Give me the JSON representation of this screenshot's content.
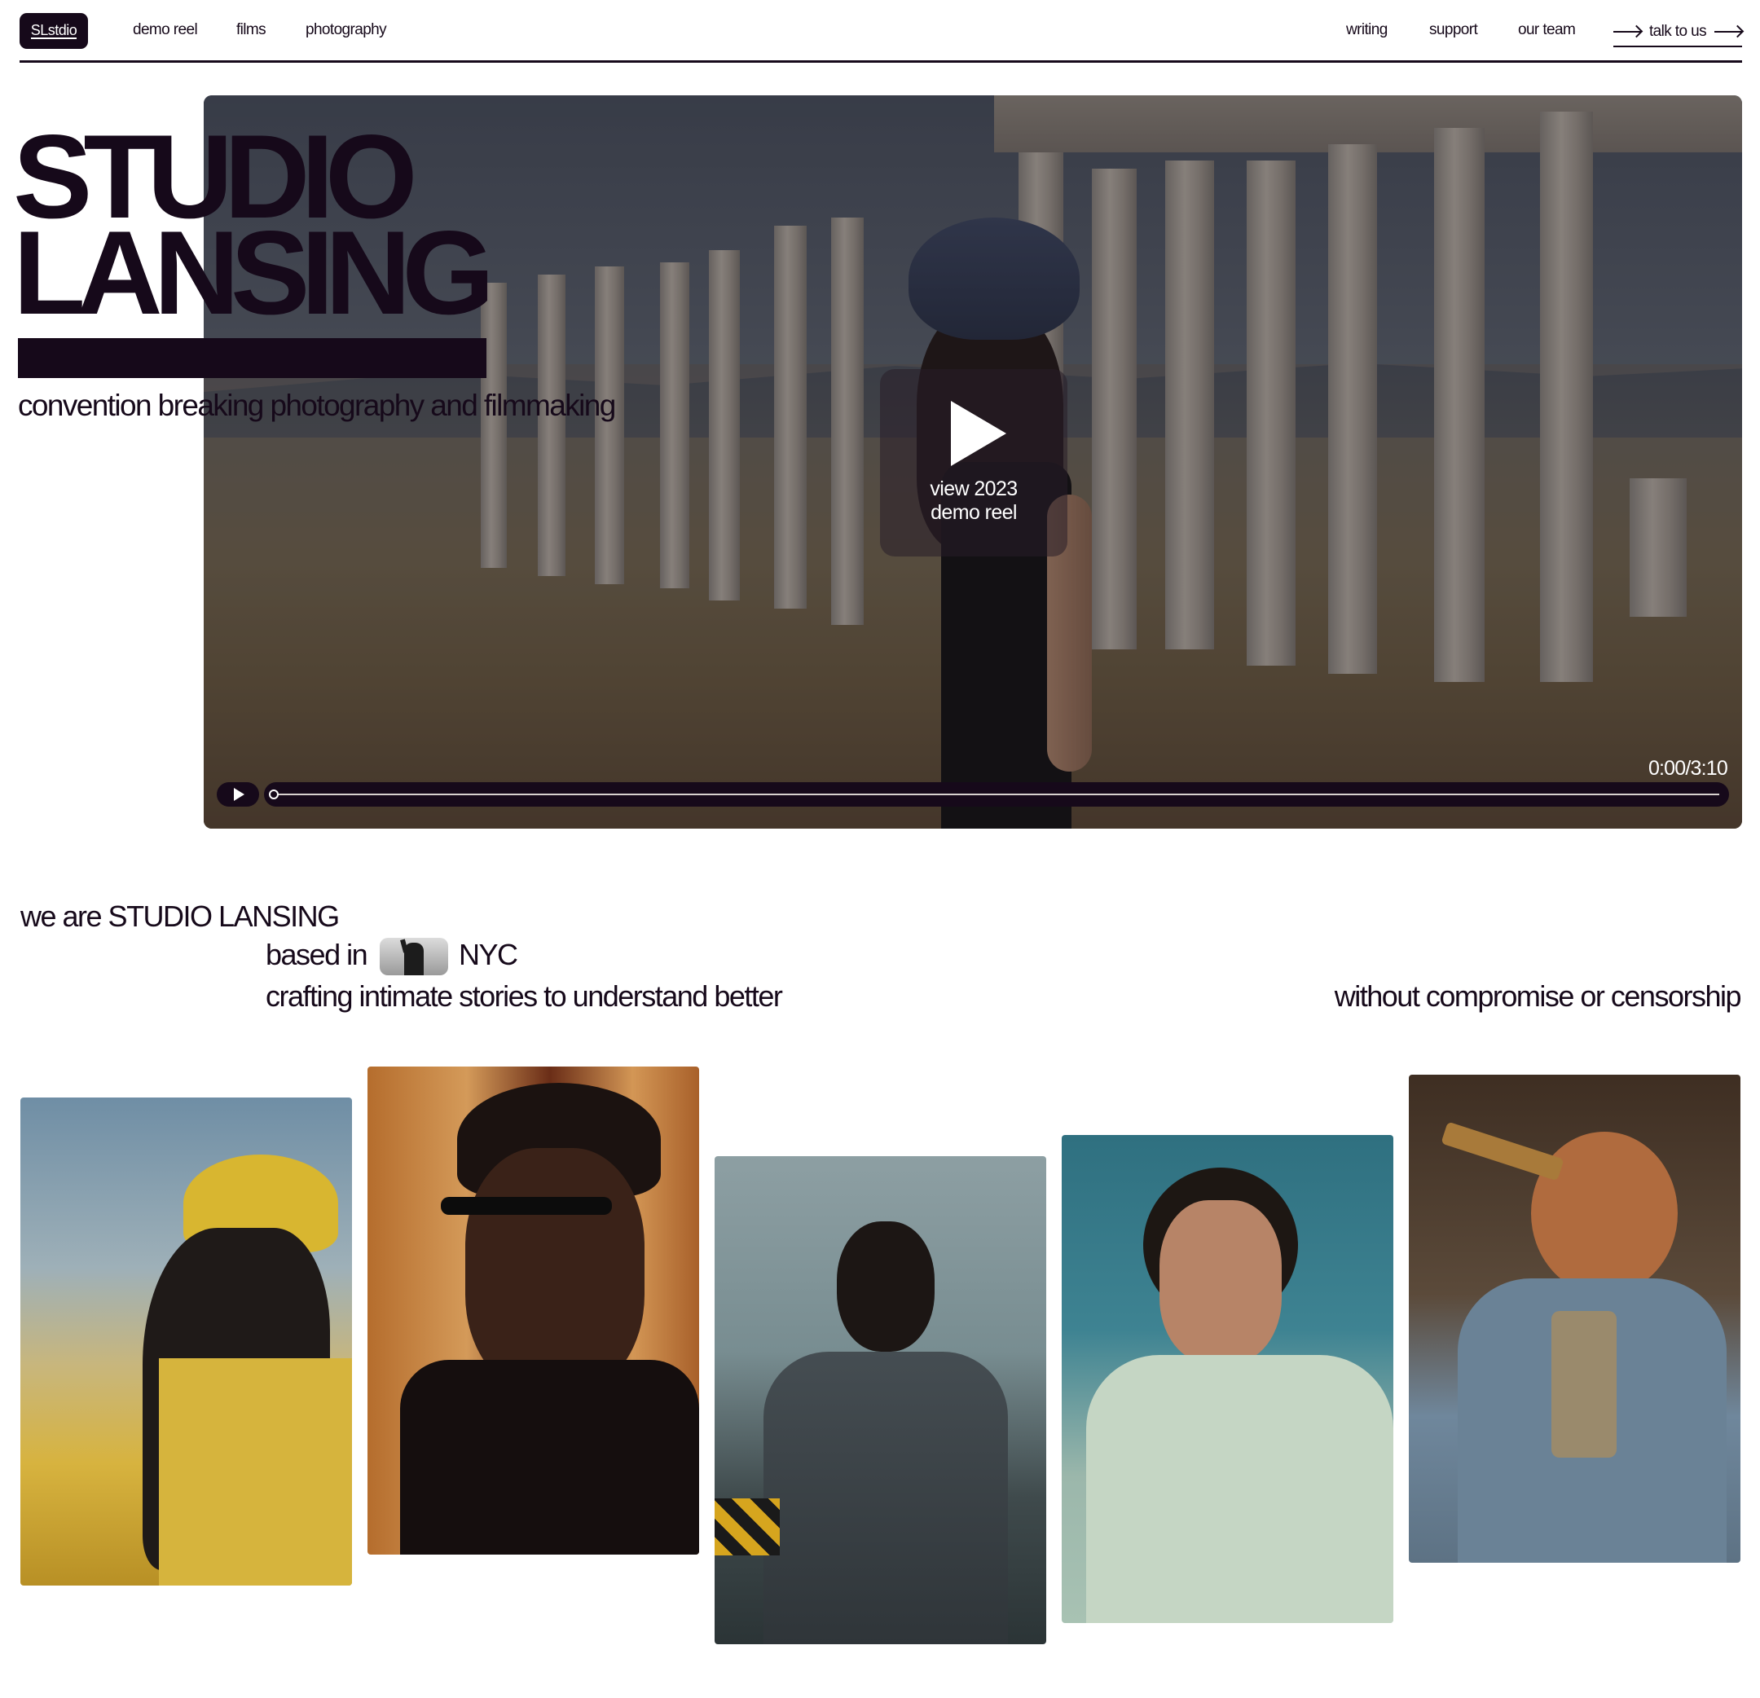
{
  "nav": {
    "logo": "SLstdio",
    "left_links": [
      "demo reel",
      "films",
      "photography"
    ],
    "right_links": [
      "writing",
      "support",
      "our team"
    ],
    "cta": "talk to us"
  },
  "hero": {
    "title_line1": "STUDIO",
    "title_line2": "LANSING",
    "tagline": "convention breaking photography and filmmaking",
    "play_card_line1": "view 2023",
    "play_card_line2": "demo reel",
    "time": "0:00/3:10",
    "progress": 0
  },
  "intro": {
    "line1": "we are STUDIO LANSING",
    "line2_pre": "based in",
    "line2_post": "NYC",
    "line3": "crafting intimate stories to understand better",
    "line3_right": "without compromise or censorship"
  },
  "icons": {
    "play": "play-icon",
    "arrow": "arrow-right-icon",
    "liberty": "statue-of-liberty-thumbnail"
  },
  "colors": {
    "ink": "#16091a",
    "background": "#ffffff"
  }
}
